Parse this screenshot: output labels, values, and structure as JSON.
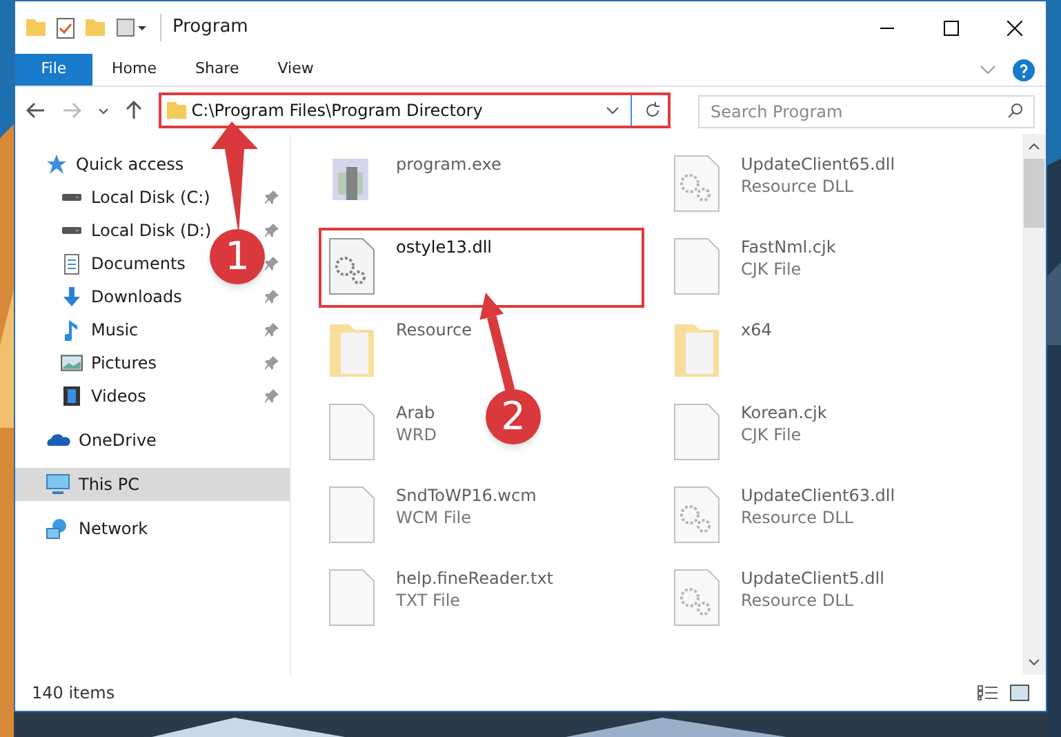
{
  "window": {
    "title": "Program"
  },
  "ribbon_tabs": [
    {
      "label": "File",
      "selected": true
    },
    {
      "label": "Home",
      "selected": false
    },
    {
      "label": "Share",
      "selected": false
    },
    {
      "label": "View",
      "selected": false
    }
  ],
  "address": {
    "value": "C:\\Program Files\\Program Directory",
    "highlighted": true
  },
  "search": {
    "placeholder": "Search Program"
  },
  "sidebar": {
    "items": [
      {
        "label": "Quick access",
        "selected": false,
        "children": [
          {
            "label": "Local Disk (C:)",
            "pinned": true,
            "selected": false
          },
          {
            "label": "Local Disk (D:)",
            "pinned": true,
            "selected": false
          },
          {
            "label": "Documents",
            "pinned": true,
            "selected": false
          },
          {
            "label": "Downloads",
            "pinned": true,
            "selected": false
          },
          {
            "label": "Music",
            "pinned": true,
            "selected": false
          },
          {
            "label": "Pictures",
            "pinned": true,
            "selected": false
          },
          {
            "label": "Videos",
            "pinned": true,
            "selected": false
          }
        ]
      },
      {
        "label": "OneDrive",
        "selected": false
      },
      {
        "label": "This PC",
        "selected": true
      },
      {
        "label": "Network",
        "selected": false
      }
    ]
  },
  "files": [
    {
      "name": "program.exe",
      "kind": "exe",
      "highlighted": false
    },
    {
      "name": "UpdateClient65.dll",
      "type": "Resource DLL",
      "kind": "dll",
      "highlighted": false
    },
    {
      "name": "ostyle13.dll",
      "kind": "dll",
      "highlighted": true
    },
    {
      "name": "FastNml.cjk",
      "type": "CJK File",
      "kind": "file",
      "highlighted": false
    },
    {
      "name": "Resource",
      "kind": "folder",
      "highlighted": false
    },
    {
      "name": "x64",
      "kind": "folder",
      "highlighted": false
    },
    {
      "name": "Arab",
      "type": "WRD",
      "kind": "file",
      "highlighted": false
    },
    {
      "name": "Korean.cjk",
      "type": "CJK File",
      "kind": "file",
      "highlighted": false
    },
    {
      "name": "SndToWP16.wcm",
      "type": "WCM File",
      "kind": "file",
      "highlighted": false
    },
    {
      "name": "UpdateClient63.dll",
      "type": "Resource DLL",
      "kind": "dll",
      "highlighted": false
    },
    {
      "name": "help.fineReader.txt",
      "type": "TXT File",
      "kind": "file",
      "highlighted": false
    },
    {
      "name": "UpdateClient5.dll",
      "type": "Resource DLL",
      "kind": "dll",
      "highlighted": false
    }
  ],
  "callouts": [
    {
      "label": "1"
    },
    {
      "label": "2"
    }
  ],
  "status_bar": {
    "count": "140 items"
  }
}
